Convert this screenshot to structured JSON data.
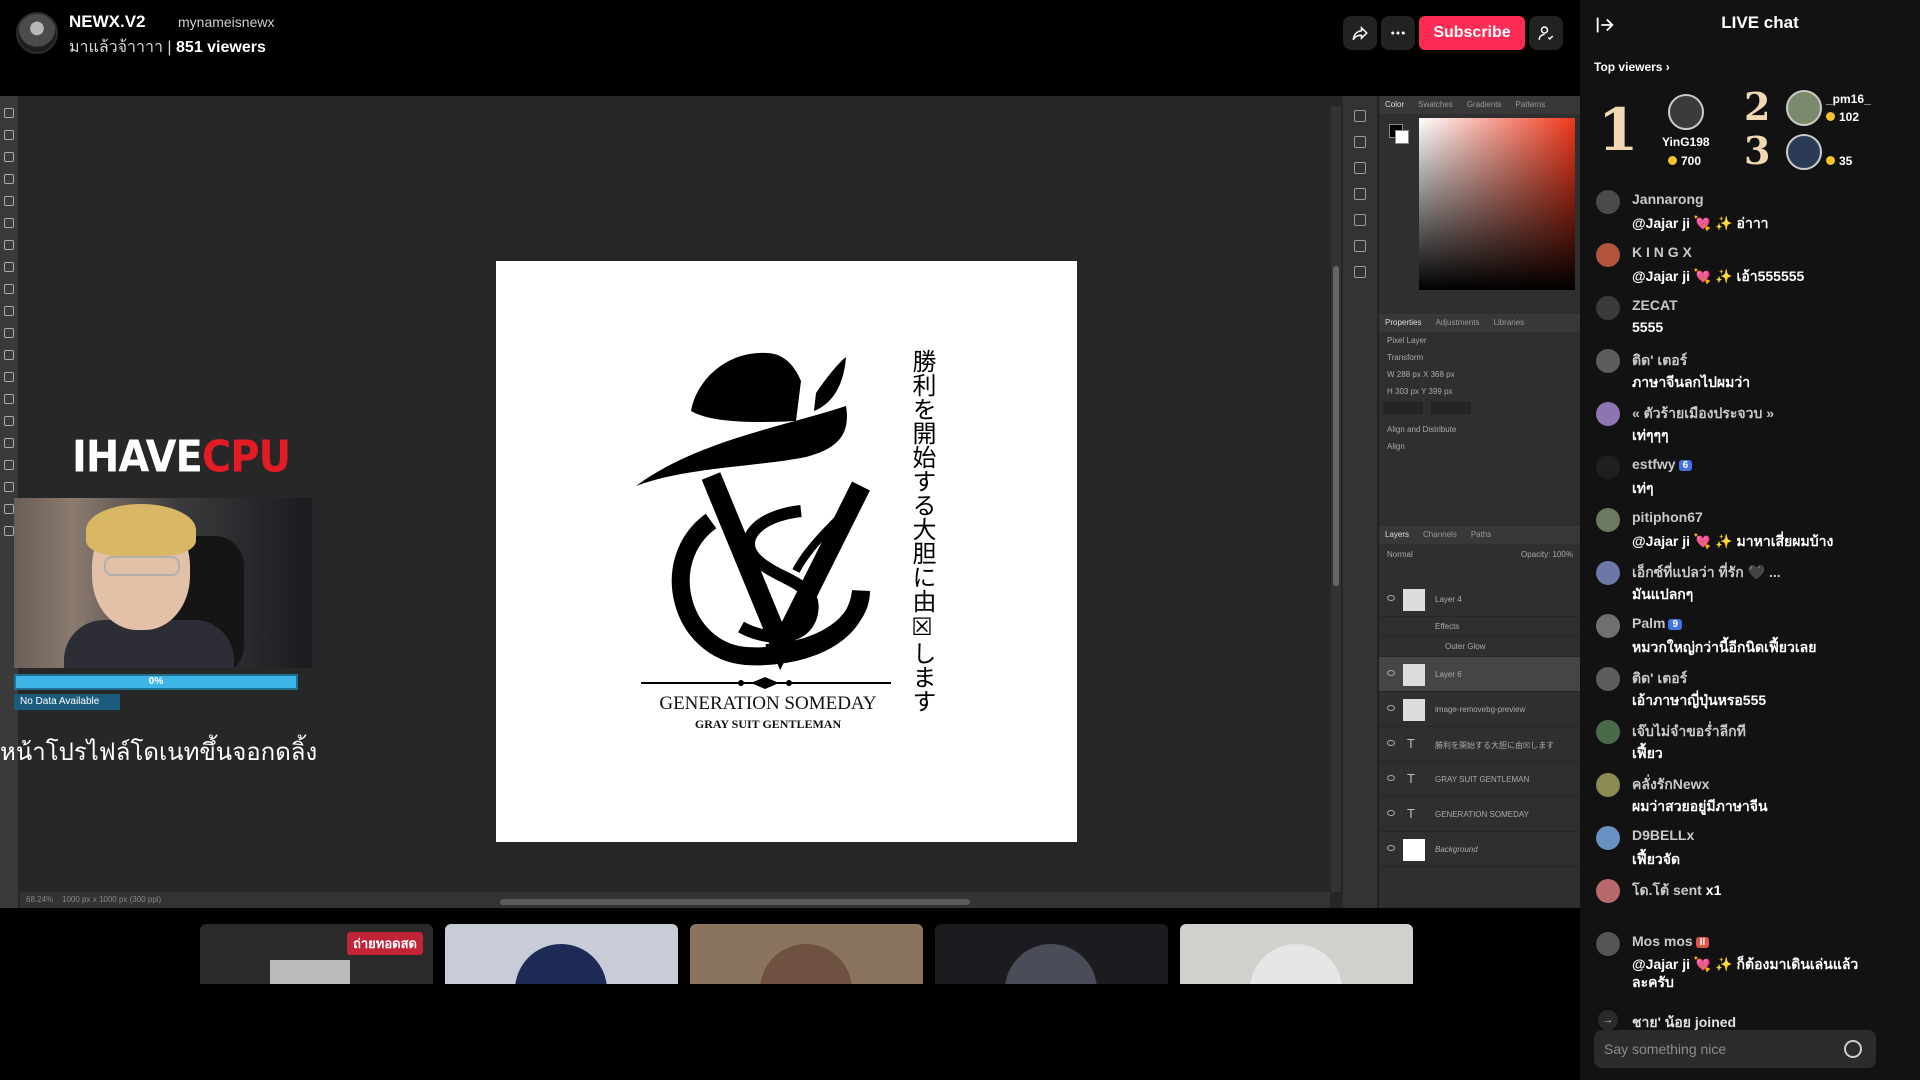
{
  "header": {
    "host_name": "NEWX.V2",
    "host_handle": "mynameisnewx",
    "stream_title": "มาแล้วจ้าาาา",
    "viewers": "851 viewers",
    "subscribe_label": "Subscribe",
    "icons": [
      "share-icon",
      "more-icon",
      "profile-icon"
    ],
    "accent_color": "#fe2c55"
  },
  "stream_overlay": {
    "logo_part_white": "IHAVE",
    "logo_part_red": "CPU",
    "goal_progress": "0%",
    "goal_progress_value": 0,
    "no_data": "No Data Available",
    "caption": "หน้าโปรไฟล์โดเนทขึ้นจอกดลิ้ง"
  },
  "artwork": {
    "brand": "GENERATION SOMEDAY",
    "tagline": "GRAY SUIT GENTLEMAN",
    "vertical_text": "勝利を開始する大胆に由☒します",
    "monogram": "VSG"
  },
  "photoshop": {
    "panel_tabs_top": [
      "Color",
      "Swatches",
      "Gradients",
      "Patterns"
    ],
    "panel_tabs_props": [
      "Properties",
      "Adjustments",
      "Libraries"
    ],
    "props_lines": [
      "Pixel Layer",
      "Transform",
      "W 288 px   X 368 px",
      "H 303 px   Y 399 px",
      "Align and Distribute",
      "Align"
    ],
    "panel_tabs_layers": [
      "Layers",
      "Channels",
      "Paths"
    ],
    "layer_mode": "Normal",
    "layer_opacity": "Opacity: 100%",
    "layers": [
      {
        "name": "Layer 4",
        "type": "pixel"
      },
      {
        "name": "Effects",
        "type": "fx"
      },
      {
        "name": "Outer Glow",
        "type": "fx"
      },
      {
        "name": "Layer 6",
        "type": "pixel"
      },
      {
        "name": "image-removebg-preview",
        "type": "pixel"
      },
      {
        "name": "勝利を開始する大胆に由☒します",
        "type": "text"
      },
      {
        "name": "GRAY SUIT GENTLEMAN",
        "type": "text"
      },
      {
        "name": "GENERATION SOMEDAY",
        "type": "text"
      },
      {
        "name": "Background",
        "type": "pixel"
      }
    ],
    "status_zoom": "68.24%",
    "status_doc": "1000 px x 1000 px (300 ppi)"
  },
  "thumbnails": [
    {
      "live_label": "ถ่ายทอดสด",
      "color": "#2a2a2a"
    },
    {
      "live_label": "",
      "color": "#c8ccd8"
    },
    {
      "live_label": "",
      "color": "#8a7460"
    },
    {
      "live_label": "",
      "color": "#1c1c20"
    },
    {
      "live_label": "",
      "color": "#d0d0cc"
    }
  ],
  "chat": {
    "title": "LIVE chat",
    "top_viewers_label": "Top viewers",
    "top_viewers": [
      {
        "rank": "1",
        "name": "YinG198",
        "coins": "700"
      },
      {
        "rank": "2",
        "name": "_pm16_",
        "coins": "102"
      },
      {
        "rank": "3",
        "name": "",
        "coins": "35"
      }
    ],
    "messages": [
      {
        "name": "Jannarong",
        "badge": "",
        "text": "@Jajar ji 💘 ✨ อ่าาา",
        "av": "#4a4a4a"
      },
      {
        "name": "K I N G X",
        "badge": "",
        "text": "@Jajar ji 💘 ✨ เอ้า555555",
        "av": "#b2543b"
      },
      {
        "name": "ZECAT",
        "badge": "",
        "text": "5555",
        "av": "#3a3a3a"
      },
      {
        "name": "ติด' เตอร์",
        "badge": "",
        "text": "ภาษาจีนลกไปผมว่า",
        "av": "#5d5d5d"
      },
      {
        "name": "« ตัวร้ายเมืองประจวบ »",
        "badge": "",
        "text": "เท่ๆๆๆ",
        "av": "#8e74b3"
      },
      {
        "name": "estfwy",
        "badge": "6",
        "text": "เท่ๆ",
        "av": "#1f1f1f"
      },
      {
        "name": "pitiphon67",
        "badge": "",
        "text": "@Jajar ji 💘 ✨ มาหาเสี่ยผมบ้าง",
        "av": "#6c7a62"
      },
      {
        "name": "เอ็กซ์ที่แปลว่า ที่รัก 🖤 ...",
        "badge": "",
        "text": "มันแปลกๆ",
        "av": "#6b78a8"
      },
      {
        "name": "Palm",
        "badge": "9",
        "text": "หมวกใหญ่กว่านี้อีกนิดเฟี้ยวเลย",
        "av": "#707070"
      },
      {
        "name": "ติด' เตอร์",
        "badge": "",
        "text": "เอ้าภาษาญี่ปุ่นหรอ555",
        "av": "#5d5d5d"
      },
      {
        "name": "เจ๊บไม่จำขอร่ำลีกที",
        "badge": "",
        "text": "เฟี้ยว",
        "av": "#4a6b4a"
      },
      {
        "name": "คลั่งรักNewx",
        "badge": "",
        "text": "ผมว่าสวยอยู่มีภาษาจีน",
        "av": "#8a8a52"
      },
      {
        "name": "D9BELLx",
        "badge": "",
        "text": "เฟี้ยวจัด",
        "av": "#6a90c4"
      },
      {
        "name": "โด.โต้ sent",
        "badge": "",
        "text": "",
        "gift": "x1",
        "av": "#b86a6a"
      },
      {
        "name": "Mos mos",
        "badge": "II",
        "badge_red": true,
        "text": "@Jajar ji 💘 ✨ ก็ต้องมาเดินเล่นแล้วละครับ",
        "av": "#555"
      },
      {
        "name": "",
        "badge": "",
        "text": "ชาย' น้อย joined",
        "join": true,
        "av": "#2a2a2a"
      }
    ],
    "input_placeholder": "Say something nice"
  }
}
